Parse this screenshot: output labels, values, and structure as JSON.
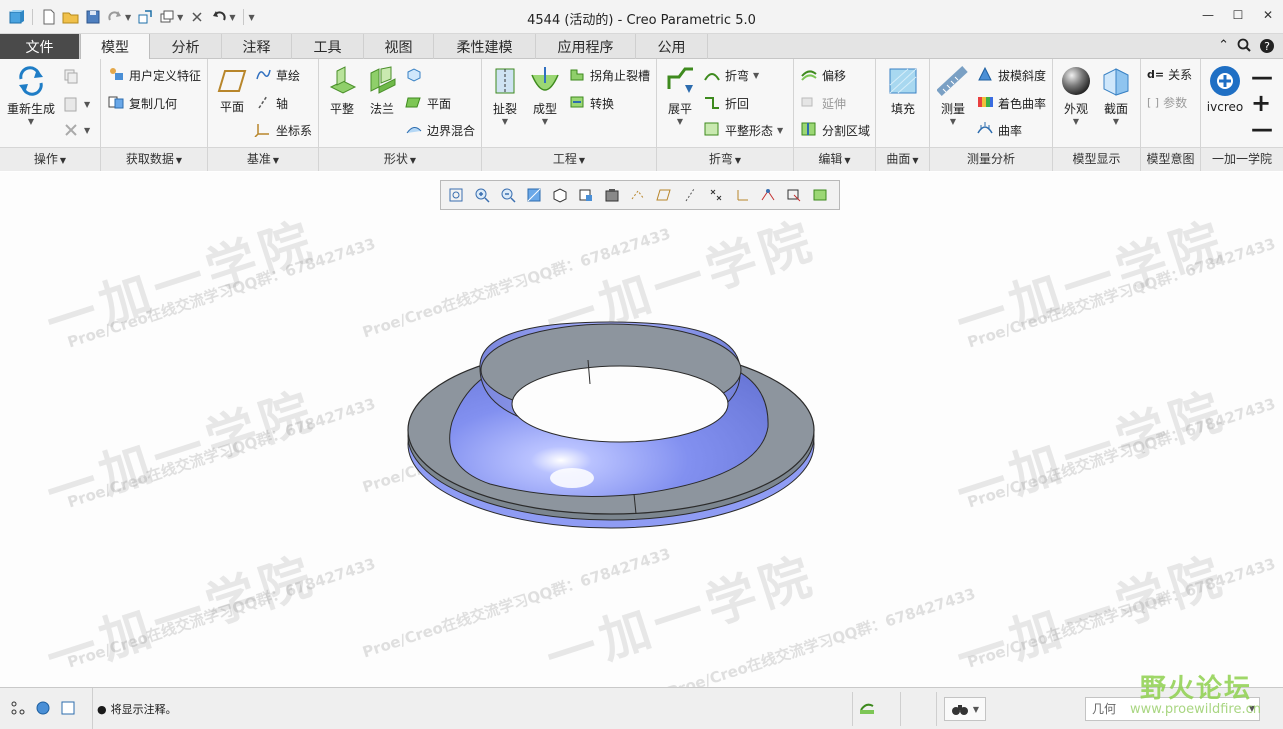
{
  "window": {
    "title": "4544 (活动的) - Creo Parametric 5.0"
  },
  "tabs": [
    {
      "label": "文件"
    },
    {
      "label": "模型"
    },
    {
      "label": "分析"
    },
    {
      "label": "注释"
    },
    {
      "label": "工具"
    },
    {
      "label": "视图"
    },
    {
      "label": "柔性建模"
    },
    {
      "label": "应用程序"
    },
    {
      "label": "公用"
    }
  ],
  "ribbon": {
    "ops": {
      "regen": "重新生成",
      "label": "操作"
    },
    "getdata": {
      "udf": "用户定义特征",
      "copygeom": "复制几何",
      "label": "获取数据"
    },
    "datum": {
      "plane": "平面",
      "sketch": "草绘",
      "axis": "轴",
      "csys": "坐标系",
      "label": "基准"
    },
    "shape": {
      "flat": "平整",
      "flange": "法兰",
      "plane": "平面",
      "blend": "边界混合",
      "label": "形状"
    },
    "eng": {
      "rip": "扯裂",
      "form": "成型",
      "corner": "拐角止裂槽",
      "convert": "转换",
      "label": "工程"
    },
    "bend": {
      "unbend": "展平",
      "bend": "折弯",
      "bendback": "折回",
      "flatpattern": "平整形态",
      "label": "折弯"
    },
    "edit": {
      "offset": "偏移",
      "extend": "延伸",
      "split": "分割区域",
      "label": "编辑"
    },
    "surface": {
      "fill": "填充",
      "label": "曲面"
    },
    "measure": {
      "measure": "测量",
      "draft": "拔模斜度",
      "shade": "着色曲率",
      "curv": "曲率",
      "label": "测量分析"
    },
    "display": {
      "appearance": "外观",
      "section": "截面",
      "label": "模型显示"
    },
    "intent": {
      "relations": "关系",
      "params": "参数",
      "label": "模型意图"
    },
    "yijia": {
      "name": "ivcreo",
      "label": "一加一学院"
    }
  },
  "watermark": {
    "text": "Proe/Creo在线交流学习QQ群：678427433",
    "big": "一加一学院"
  },
  "status": {
    "message": "将显示注释。",
    "filter": "几何"
  },
  "brand": {
    "name": "野火论坛",
    "url": "www.proewildfire.cn"
  },
  "colors": {
    "file_tab": "#4a4a4a",
    "part_top": "#8d959e",
    "part_blue": "#8f9cf4"
  }
}
